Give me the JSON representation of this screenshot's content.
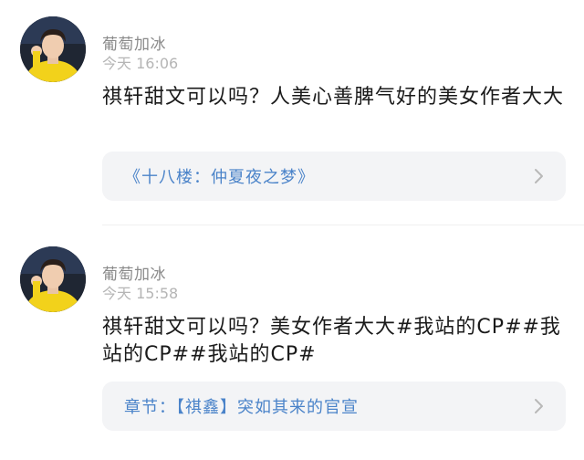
{
  "comments": [
    {
      "username": "葡萄加冰",
      "timestamp": "今天 16:06",
      "content": "祺轩甜文可以吗？人美心善脾气好的美女作者大大",
      "card": {
        "text": "《十八楼：仲夏夜之梦》",
        "icon": "chevron-right-icon"
      }
    },
    {
      "username": "葡萄加冰",
      "timestamp": "今天 15:58",
      "content": "祺轩甜文可以吗？美女作者大大#我站的CP##我站的CP##我站的CP#",
      "card": {
        "text": "章节：【祺鑫】突如其来的官宣",
        "icon": "chevron-right-icon"
      }
    }
  ],
  "colors": {
    "link_blue": "#4a83c9",
    "card_bg": "#f3f4f6",
    "meta_gray": "#b5b5b5",
    "avatar_shirt": "#f2d21b"
  }
}
